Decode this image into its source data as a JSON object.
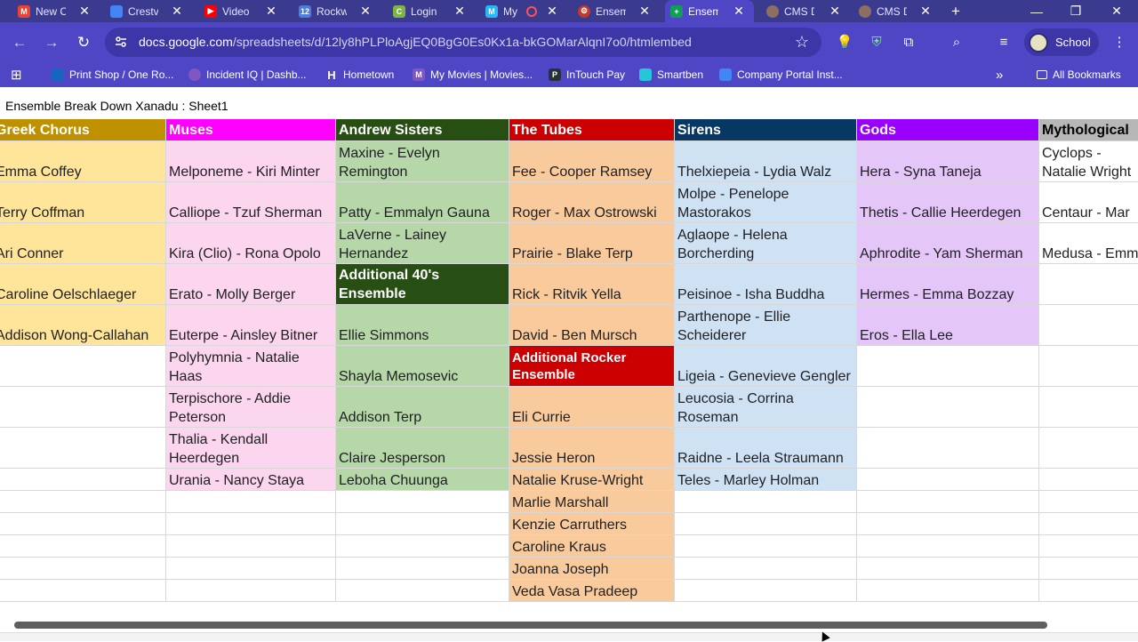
{
  "browser": {
    "tabs": [
      {
        "title": "New C",
        "icon": "gmail-icon",
        "color": "#ea4335",
        "glyph": "M"
      },
      {
        "title": "Crestv",
        "icon": "docs-icon",
        "color": "#4285f4",
        "glyph": ""
      },
      {
        "title": "Video",
        "icon": "youtube-icon",
        "color": "#ff0000",
        "glyph": "▶"
      },
      {
        "title": "Rockw",
        "icon": "calendar-icon",
        "color": "#4f7bd9",
        "glyph": "12"
      },
      {
        "title": "Login",
        "icon": "classlink-icon",
        "color": "#7cb342",
        "glyph": "C"
      },
      {
        "title": "My",
        "icon": "movies-icon",
        "color": "#29b6f6",
        "glyph": "M"
      },
      {
        "title": "Ensem",
        "icon": "gear-icon",
        "color": "#c0392b",
        "glyph": "⚙"
      },
      {
        "title": "Ensem",
        "icon": "sheets-icon",
        "color": "#0f9d58",
        "glyph": "+"
      },
      {
        "title": "CMS D",
        "icon": "portal-icon",
        "color": "#8d6e63",
        "glyph": ""
      },
      {
        "title": "CMS D",
        "icon": "portal-icon",
        "color": "#8d6e63",
        "glyph": ""
      }
    ],
    "new_tab": "+",
    "url_host": "docs.google.com",
    "url_path": "/spreadsheets/d/12ly8hPLPloAgjEQ0BgG0Es0Kx1a-bkGOMarAlqnI7o0/htmlembed",
    "profile_label": "School",
    "bookmarks": [
      {
        "label": "Print Shop / One Ro...",
        "icon": "print-shop-icon",
        "color": "#1565c0"
      },
      {
        "label": "Incident IQ | Dashb...",
        "icon": "incident-iq-icon",
        "color": "#7e57c2"
      },
      {
        "label": "Hometown",
        "icon": "hometown-icon",
        "color": "#ffffff"
      },
      {
        "label": "My Movies | Movies...",
        "icon": "movies-icon",
        "color": "#7e57c2"
      },
      {
        "label": "InTouch Pay",
        "icon": "intouch-pay-icon",
        "color": "#263238"
      },
      {
        "label": "Smartben",
        "icon": "smartben-icon",
        "color": "#26c6da"
      },
      {
        "label": "Company Portal Inst...",
        "icon": "document-icon",
        "color": "#4285f4"
      }
    ],
    "all_bookmarks": "All Bookmarks"
  },
  "sheet": {
    "title": "Ensemble Break Down Xanadu : Sheet1",
    "columns": [
      {
        "header": "Greek Chorus",
        "hdr_bg": "#bf9000",
        "hdr_fg": "#ffffff",
        "body_bg": "#ffe599",
        "cells": [
          "Emma Coffey",
          "Terry Coffman",
          "Ari Conner",
          "Caroline Oelschlaeger",
          "Addison Wong-Callahan"
        ]
      },
      {
        "header": "Muses",
        "hdr_bg": "#ff00ff",
        "hdr_fg": "#ffffff",
        "body_bg": "#fcd5ee",
        "cells": [
          "Melponeme - Kiri Minter",
          "Calliope - Tzuf Sherman",
          "Kira (Clio) - Rona Opolo",
          "Erato - Molly Berger",
          "Euterpe - Ainsley Bitner",
          "Polyhymnia - Natalie Haas",
          "Terpischore - Addie Peterson",
          "Thalia - Kendall Heerdegen",
          "Urania - Nancy Staya"
        ]
      },
      {
        "header": "Andrew Sisters",
        "hdr_bg": "#274e13",
        "hdr_fg": "#ffffff",
        "body_bg": "#b6d7a8",
        "cells": [
          "Maxine - Evelyn Remington",
          "Patty - Emmalyn Gauna",
          "LaVerne - Lainey Hernandez"
        ],
        "subheader": "Additional 40's Ensemble",
        "more": [
          "Ellie Simmons",
          "Shayla Memosevic",
          "Addison Terp",
          "Claire Jesperson",
          "Leboha Chuunga"
        ]
      },
      {
        "header": "The Tubes",
        "hdr_bg": "#cc0000",
        "hdr_fg": "#ffffff",
        "body_bg": "#f9cb9c",
        "cells": [
          "Fee - Cooper Ramsey",
          "Roger - Max Ostrowski",
          "Prairie - Blake Terp",
          "Rick - Ritvik Yella",
          "David - Ben Mursch"
        ],
        "subheader": "Additional Rocker Ensemble",
        "more": [
          "Eli Currie",
          "Jessie Heron",
          "Natalie Kruse-Wright",
          "Marlie Marshall",
          "Kenzie Carruthers",
          "Caroline Kraus",
          "Joanna Joseph",
          "Veda Vasa Pradeep"
        ]
      },
      {
        "header": "Sirens",
        "hdr_bg": "#073763",
        "hdr_fg": "#ffffff",
        "body_bg": "#cfe2f3",
        "cells": [
          "Thelxiepeia - Lydia Walz",
          "Molpe - Penelope Mastorakos",
          "Aglaope - Helena Borcherding",
          "Peisinoe - Isha Buddha",
          "Parthenope - Ellie Scheiderer",
          "Ligeia - Genevieve Gengler",
          "Leucosia - Corrina Roseman",
          "Raidne - Leela Straumann",
          "Teles - Marley Holman"
        ]
      },
      {
        "header": "Gods",
        "hdr_bg": "#9900ff",
        "hdr_fg": "#ffffff",
        "body_bg": "#e4c7f8",
        "cells": [
          "Hera - Syna Taneja",
          "Thetis - Callie Heerdegen",
          "Aphrodite - Yam Sherman",
          "Hermes - Emma Bozzay",
          "Eros - Ella Lee"
        ]
      },
      {
        "header": "Mythological",
        "hdr_bg": "#b7b7b7",
        "hdr_fg": "#000000",
        "body_bg": "#ffffff",
        "cells": [
          "Cyclops - Natalie Wright",
          "Centaur - Mar",
          "Medusa - Emm"
        ]
      }
    ]
  }
}
